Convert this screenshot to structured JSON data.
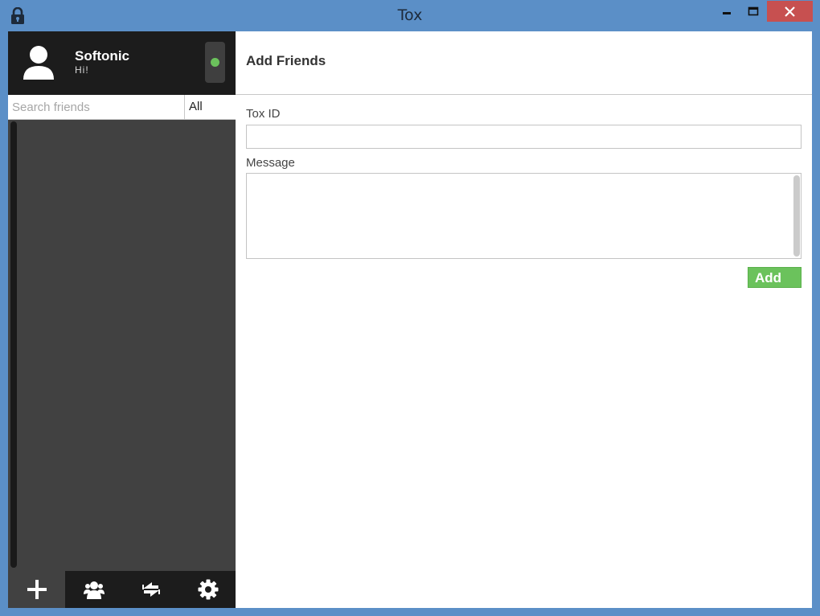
{
  "window": {
    "title": "Tox",
    "icons": {
      "app": "tox-lock-icon",
      "minimize": "minimize-icon",
      "maximize": "maximize-icon",
      "close": "close-icon"
    }
  },
  "profile": {
    "name": "Softonic",
    "status_message": "Hi!",
    "avatar_icon": "user-avatar-icon",
    "status": "online",
    "status_color": "#6bc25c"
  },
  "search": {
    "placeholder": "Search friends",
    "value": "",
    "filter": "All"
  },
  "bottom_bar": [
    {
      "icon": "add-icon",
      "active": true
    },
    {
      "icon": "group-icon",
      "active": false
    },
    {
      "icon": "file-transfer-icon",
      "active": false
    },
    {
      "icon": "settings-gear-icon",
      "active": false
    }
  ],
  "add_friends": {
    "title": "Add Friends",
    "tox_id_label": "Tox ID",
    "tox_id_value": "",
    "message_label": "Message",
    "message_value": "",
    "add_button": "Add"
  },
  "colors": {
    "titlebar": "#5b8fc7",
    "close": "#c75050",
    "sidebar": "#414141",
    "sidebar_dark": "#1c1c1c",
    "accent_green": "#6bc25c"
  }
}
